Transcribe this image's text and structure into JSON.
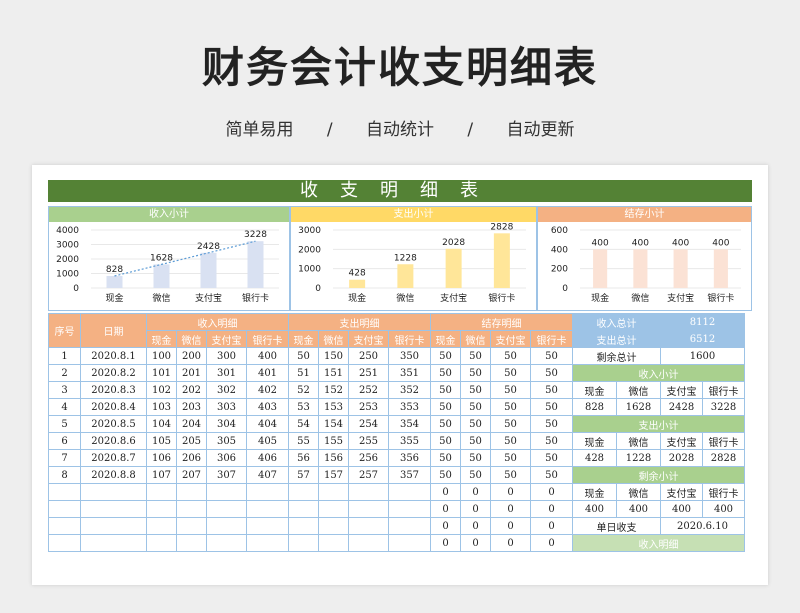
{
  "header": {
    "title": "财务会计收支明细表",
    "subtitles": [
      "简单易用",
      "/",
      "自动统计",
      "/",
      "自动更新"
    ]
  },
  "sheet": {
    "banner": "收支明细表",
    "colors": {
      "banner": "#548235",
      "income": "#a9d08e",
      "expense": "#ffd966",
      "balance": "#f4b183",
      "grid": "#9dc3e6"
    }
  },
  "chart_data": [
    {
      "type": "bar",
      "title": "收入小计",
      "categories": [
        "现金",
        "微信",
        "支付宝",
        "银行卡"
      ],
      "values": [
        828,
        1628,
        2428,
        3228
      ],
      "yticks": [
        0,
        1000,
        2000,
        3000,
        4000
      ],
      "ylim": [
        0,
        4000
      ],
      "trendline": true,
      "bar_color": "#d9e1f2"
    },
    {
      "type": "bar",
      "title": "支出小计",
      "categories": [
        "现金",
        "微信",
        "支付宝",
        "银行卡"
      ],
      "values": [
        428,
        1228,
        2028,
        2828
      ],
      "yticks": [
        0,
        1000,
        2000,
        3000
      ],
      "ylim": [
        0,
        3000
      ],
      "bar_color": "#ffe699"
    },
    {
      "type": "bar",
      "title": "结存小计",
      "categories": [
        "现金",
        "微信",
        "支付宝",
        "银行卡"
      ],
      "values": [
        400,
        400,
        400,
        400
      ],
      "yticks": [
        0,
        200,
        400,
        600
      ],
      "ylim": [
        0,
        600
      ],
      "bar_color": "#fbe2d5"
    }
  ],
  "table": {
    "headers": {
      "seq": "序号",
      "date": "日期",
      "income": "收入明细",
      "expense": "支出明细",
      "balance": "结存明细"
    },
    "sub_headers": [
      "现金",
      "微信",
      "支付宝",
      "银行卡"
    ],
    "rows": [
      [
        "1",
        "2020.8.1",
        "100",
        "200",
        "300",
        "400",
        "50",
        "150",
        "250",
        "350",
        "50",
        "50",
        "50",
        "50"
      ],
      [
        "2",
        "2020.8.2",
        "101",
        "201",
        "301",
        "401",
        "51",
        "151",
        "251",
        "351",
        "50",
        "50",
        "50",
        "50"
      ],
      [
        "3",
        "2020.8.3",
        "102",
        "202",
        "302",
        "402",
        "52",
        "152",
        "252",
        "352",
        "50",
        "50",
        "50",
        "50"
      ],
      [
        "4",
        "2020.8.4",
        "103",
        "203",
        "303",
        "403",
        "53",
        "153",
        "253",
        "353",
        "50",
        "50",
        "50",
        "50"
      ],
      [
        "5",
        "2020.8.5",
        "104",
        "204",
        "304",
        "404",
        "54",
        "154",
        "254",
        "354",
        "50",
        "50",
        "50",
        "50"
      ],
      [
        "6",
        "2020.8.6",
        "105",
        "205",
        "305",
        "405",
        "55",
        "155",
        "255",
        "355",
        "50",
        "50",
        "50",
        "50"
      ],
      [
        "7",
        "2020.8.7",
        "106",
        "206",
        "306",
        "406",
        "56",
        "156",
        "256",
        "356",
        "50",
        "50",
        "50",
        "50"
      ],
      [
        "8",
        "2020.8.8",
        "107",
        "207",
        "307",
        "407",
        "57",
        "157",
        "257",
        "357",
        "50",
        "50",
        "50",
        "50"
      ],
      [
        "",
        "",
        "",
        "",
        "",
        "",
        "",
        "",
        "",
        "",
        "0",
        "0",
        "0",
        "0"
      ],
      [
        "",
        "",
        "",
        "",
        "",
        "",
        "",
        "",
        "",
        "",
        "0",
        "0",
        "0",
        "0"
      ],
      [
        "",
        "",
        "",
        "",
        "",
        "",
        "",
        "",
        "",
        "",
        "0",
        "0",
        "0",
        "0"
      ],
      [
        "",
        "",
        "",
        "",
        "",
        "",
        "",
        "",
        "",
        "",
        "0",
        "0",
        "0",
        "0"
      ]
    ]
  },
  "summary": {
    "income_total_label": "收入总计",
    "income_total": "8112",
    "expense_total_label": "支出总计",
    "expense_total": "6512",
    "remaining_label": "剩余总计",
    "remaining": "1600",
    "income_sub_label": "收入小计",
    "expense_sub_label": "支出小计",
    "balance_sub_label": "剩余小计",
    "cols": [
      "现金",
      "微信",
      "支付宝",
      "银行卡"
    ],
    "income_vals": [
      "828",
      "1628",
      "2428",
      "3228"
    ],
    "expense_vals": [
      "428",
      "1228",
      "2028",
      "2828"
    ],
    "balance_vals": [
      "400",
      "400",
      "400",
      "400"
    ],
    "daily_label": "单日收支",
    "daily_date": "2020.6.10",
    "income_detail_label": "收入明细"
  }
}
